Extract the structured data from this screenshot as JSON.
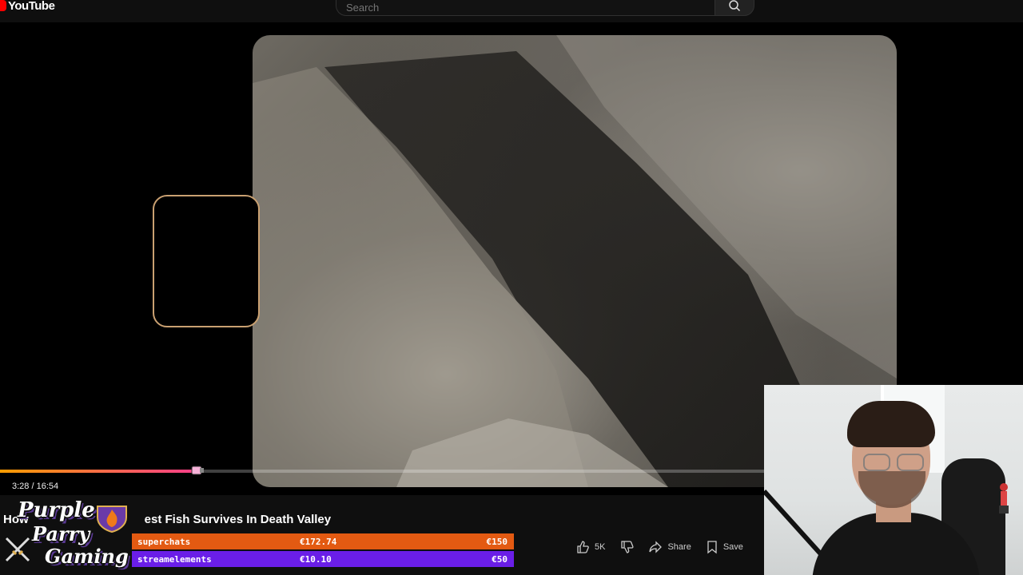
{
  "brand": {
    "logo_text": "YouTube"
  },
  "search": {
    "placeholder": "Search"
  },
  "player": {
    "time_display": "3:28 / 16:54",
    "progress_fraction": 0.205
  },
  "video": {
    "title_start": "How",
    "title_end": "est Fish Survives In Death Valley",
    "actions": {
      "like_count": "5K",
      "share_label": "Share",
      "save_label": "Save"
    }
  },
  "overlay": {
    "channel_brand": [
      "Purple",
      "Parry",
      "Gaming"
    ],
    "bars": [
      {
        "label": "superchats",
        "amount": "€172.74",
        "goal": "€150",
        "color": "#e35a12"
      },
      {
        "label": "streamelements",
        "amount": "€10.10",
        "goal": "€50",
        "color": "#6a1ee8"
      }
    ]
  },
  "colors": {
    "progress_start": "#ff9d00",
    "progress_end": "#ff3e8a",
    "frame_border": "#c9a071"
  }
}
